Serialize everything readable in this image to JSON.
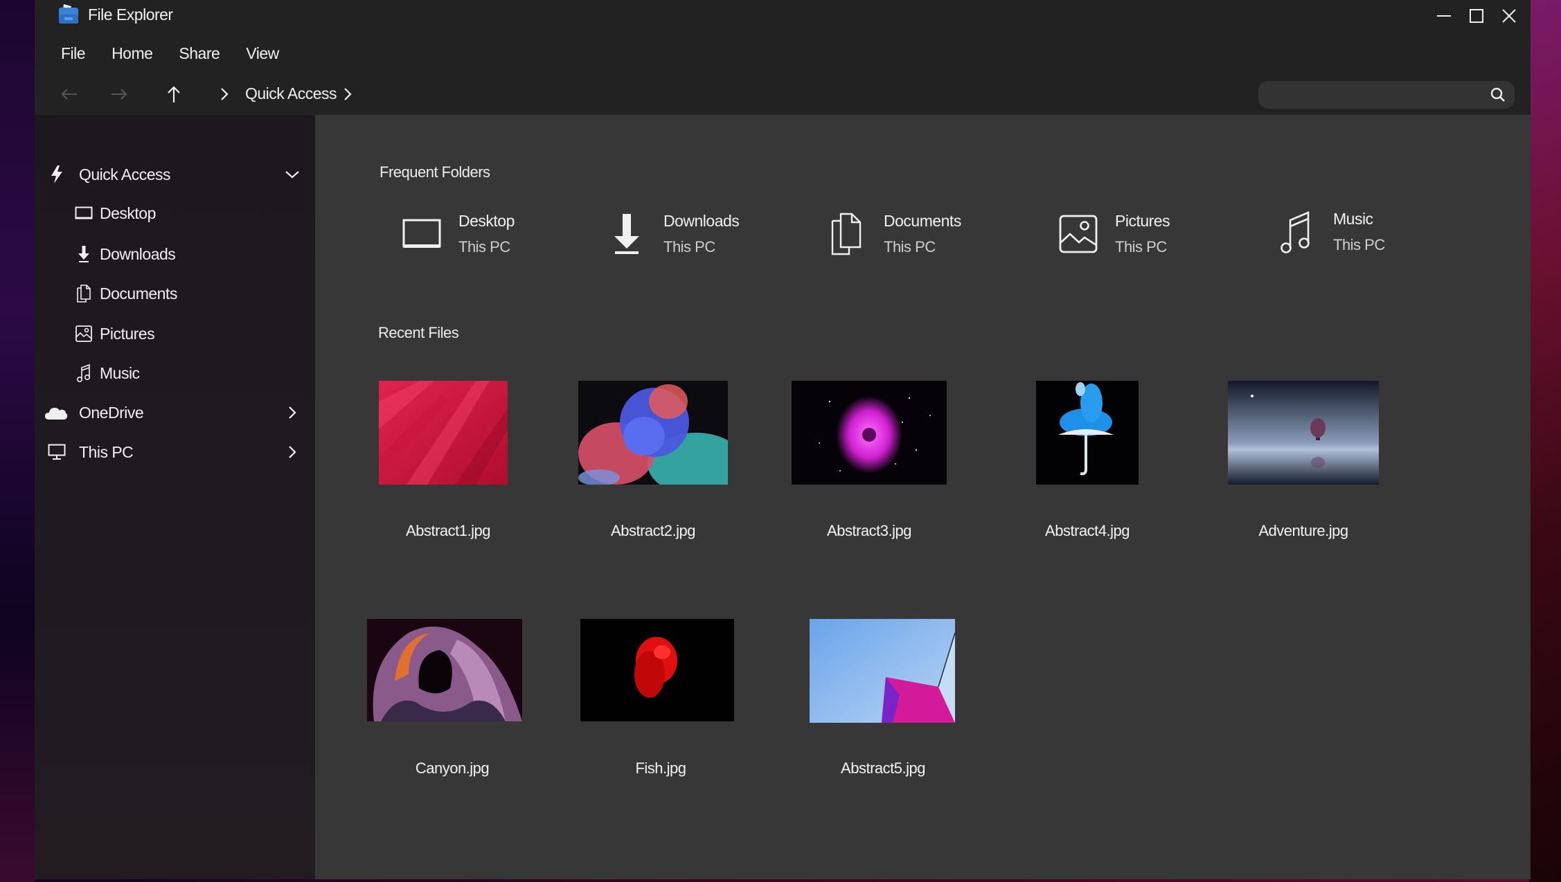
{
  "window": {
    "title": "File Explorer",
    "controls": {
      "minimize": "minimize",
      "maximize": "maximize",
      "close": "close"
    }
  },
  "menu": [
    "File",
    "Home",
    "Share",
    "View"
  ],
  "nav": {
    "breadcrumb": [
      "Quick Access"
    ],
    "search": {
      "value": "",
      "placeholder": ""
    }
  },
  "sidebar": {
    "items": [
      {
        "label": "Quick Access",
        "icon": "lightning-icon",
        "expanded": true,
        "level": 0
      },
      {
        "label": "Desktop",
        "icon": "desktop-icon",
        "level": 1
      },
      {
        "label": "Downloads",
        "icon": "download-icon",
        "level": 1
      },
      {
        "label": "Documents",
        "icon": "documents-icon",
        "level": 1
      },
      {
        "label": "Pictures",
        "icon": "pictures-icon",
        "level": 1
      },
      {
        "label": "Music",
        "icon": "music-icon",
        "level": 1
      },
      {
        "label": "OneDrive",
        "icon": "cloud-icon",
        "expanded": false,
        "level": 0
      },
      {
        "label": "This PC",
        "icon": "computer-icon",
        "expanded": false,
        "level": 0
      }
    ]
  },
  "content": {
    "frequent_title": "Frequent Folders",
    "frequent": [
      {
        "name": "Desktop",
        "location": "This PC",
        "icon": "desktop-icon"
      },
      {
        "name": "Downloads",
        "location": "This PC",
        "icon": "download-icon"
      },
      {
        "name": "Documents",
        "location": "This PC",
        "icon": "documents-icon"
      },
      {
        "name": "Pictures",
        "location": "This PC",
        "icon": "pictures-icon"
      },
      {
        "name": "Music",
        "location": "This PC",
        "icon": "music-icon"
      }
    ],
    "recent_title": "Recent Files",
    "recent": [
      {
        "name": "Abstract1.jpg",
        "thumb": "red-abstract"
      },
      {
        "name": "Abstract2.jpg",
        "thumb": "color-smoke"
      },
      {
        "name": "Abstract3.jpg",
        "thumb": "magenta-rose-space"
      },
      {
        "name": "Abstract4.jpg",
        "thumb": "umbrella-blue-smoke"
      },
      {
        "name": "Adventure.jpg",
        "thumb": "balloon-over-sea"
      },
      {
        "name": "Canyon.jpg",
        "thumb": "canyon"
      },
      {
        "name": "Fish.jpg",
        "thumb": "red-betta-fish"
      },
      {
        "name": "Abstract5.jpg",
        "thumb": "sky-magenta-building"
      }
    ]
  },
  "colors": {
    "window_bg": "#222222",
    "content_bg": "#373737",
    "sidebar_bg": "#1e1a20",
    "search_bg": "#333333",
    "text": "#f0f0f0",
    "icon_blue": "#4a90e2"
  }
}
